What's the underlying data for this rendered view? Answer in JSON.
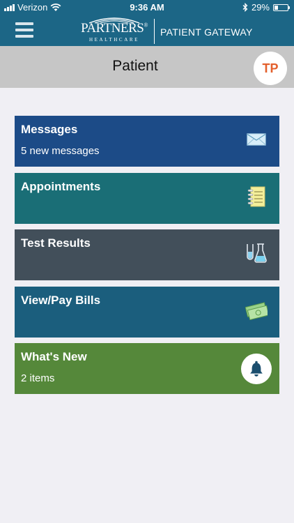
{
  "status_bar": {
    "carrier": "Verizon",
    "time": "9:36 AM",
    "battery": "29%",
    "battery_level": 0.29
  },
  "header": {
    "brand_name": "PARTNERS",
    "brand_registered": "®",
    "brand_sub": "HEALTHCARE",
    "product": "PATIENT GATEWAY"
  },
  "patient": {
    "title": "Patient",
    "initials": "TP"
  },
  "tiles": [
    {
      "label": "Messages",
      "sub": "5 new messages",
      "color": "#1c4b87",
      "icon": "envelope-icon"
    },
    {
      "label": "Appointments",
      "sub": "",
      "color": "#1a6e76",
      "icon": "notepad-icon"
    },
    {
      "label": "Test Results",
      "sub": "",
      "color": "#424f5a",
      "icon": "beaker-icon"
    },
    {
      "label": "View/Pay Bills",
      "sub": "",
      "color": "#1b5e7d",
      "icon": "money-icon"
    },
    {
      "label": "What's New",
      "sub": "2 items",
      "color": "#55883a",
      "icon": "bell-icon"
    }
  ],
  "colors": {
    "header": "#1c6686",
    "patient_bar": "#c6c6c6",
    "avatar_text": "#e35f2c",
    "background": "#f0eff4"
  }
}
